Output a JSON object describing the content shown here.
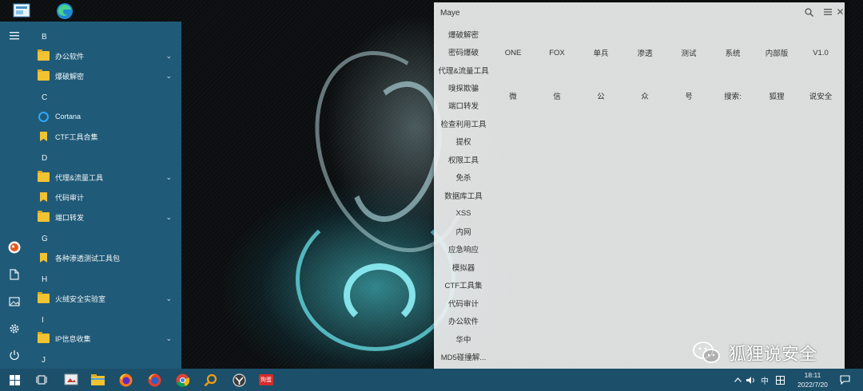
{
  "start_menu": {
    "groups": [
      {
        "letter": "B",
        "items": [
          {
            "label": "办公软件",
            "icon": "folder-icon",
            "expandable": true
          },
          {
            "label": "爆破解密",
            "icon": "folder-icon",
            "expandable": true
          }
        ]
      },
      {
        "letter": "C",
        "items": [
          {
            "label": "Cortana",
            "icon": "cortana-icon",
            "expandable": false
          },
          {
            "label": "CTF工具合集",
            "icon": "bookmark-icon",
            "expandable": false
          }
        ]
      },
      {
        "letter": "D",
        "items": [
          {
            "label": "代理&流量工具",
            "icon": "folder-icon",
            "expandable": true
          },
          {
            "label": "代码审计",
            "icon": "bookmark-icon",
            "expandable": false
          },
          {
            "label": "端口转发",
            "icon": "folder-icon",
            "expandable": true
          }
        ]
      },
      {
        "letter": "G",
        "items": [
          {
            "label": "各种渗透测试工具包",
            "icon": "bookmark-icon",
            "expandable": false
          }
        ]
      },
      {
        "letter": "H",
        "items": [
          {
            "label": "火绒安全实验室",
            "icon": "folder-icon",
            "expandable": true
          }
        ]
      },
      {
        "letter": "I",
        "items": [
          {
            "label": "IP信息收集",
            "icon": "folder-icon",
            "expandable": true
          }
        ]
      },
      {
        "letter": "J",
        "items": []
      }
    ],
    "rail": [
      "hamburger-menu-icon",
      "user-avatar-icon",
      "document-icon",
      "pictures-icon",
      "settings-gear-icon",
      "power-icon"
    ]
  },
  "maye": {
    "title": "Maye",
    "categories": [
      "爆破解密",
      "密码爆破",
      "代理&流量工具",
      "嗅探欺骗",
      "端口转发",
      "检查利用工具",
      "提权",
      "权限工具",
      "免杀",
      "数据库工具",
      "XSS",
      "内网",
      "应急响应",
      "模拟器",
      "CTF工具集",
      "代码审计",
      "办公软件",
      "华中",
      "MD5碰撞解..."
    ],
    "tool_rows": [
      [
        "ONE",
        "FOX",
        "单兵",
        "渗透",
        "测试",
        "系统",
        "内部版",
        "V1.0"
      ],
      [
        "微",
        "信",
        "公",
        "众",
        "号",
        "搜索:",
        "狐狸",
        "说安全"
      ]
    ]
  },
  "watermark": {
    "text": "狐狸说安全"
  },
  "taskbar": {
    "apps": [
      "start-windows-icon",
      "task-view-icon",
      "snipping-tool-icon",
      "file-explorer-icon",
      "firefox-icon",
      "firefox-dev-icon",
      "chrome-icon",
      "search-everything-icon",
      "proxy-tool-icon",
      "red-app-icon"
    ],
    "red_app_label": "狗蛋",
    "ime": "中",
    "time": "18:11",
    "date": "2022/7/20"
  },
  "colors": {
    "start_menu_bg": "#1f5a78",
    "taskbar_bg": "#1c4f6a",
    "folder": "#f1c232",
    "accent_cyan": "#5be6f0"
  }
}
